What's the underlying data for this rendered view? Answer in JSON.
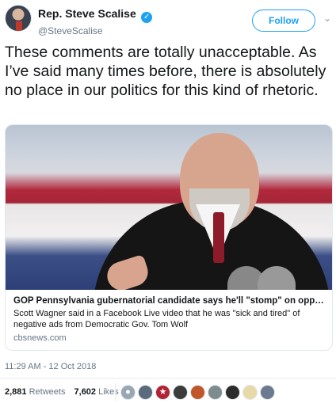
{
  "user": {
    "display_name": "Rep. Steve Scalise",
    "verified_glyph": "✓",
    "handle": "@SteveScalise"
  },
  "follow_label": "Follow",
  "more_icon": "⌄",
  "tweet_text": "These comments are totally unacceptable. As I’ve said many times before, there is absolutely no place in our politics for this kind of rhetoric.",
  "card": {
    "title": "GOP Pennsylvania gubernatorial candidate says he'll \"stomp\" on opponent's ...",
    "description": "Scott Wagner said in a Facebook Live video that he was \"sick and tired\" of negative ads from Democratic Gov. Tom Wolf",
    "domain": "cbsnews.com"
  },
  "timestamp": "11:29 AM - 12 Oct 2018",
  "stats": {
    "retweets_count": "2,881",
    "retweets_label": "Retweets",
    "likes_count": "7,602",
    "likes_label": "Likes"
  },
  "colors": {
    "accent": "#1da1f2",
    "secondary_text": "#657786"
  },
  "liker_avatars": [
    {
      "icon": "default-avatar-icon",
      "glyph": "●",
      "color": "#9aa6b2"
    },
    {
      "icon": "avatar-icon",
      "glyph": "",
      "color": "#5a6b7d"
    },
    {
      "icon": "avatar-icon",
      "glyph": "★",
      "color": "#b22234"
    },
    {
      "icon": "avatar-icon",
      "glyph": "",
      "color": "#3c3c3c"
    },
    {
      "icon": "avatar-icon",
      "glyph": "",
      "color": "#c2562b"
    },
    {
      "icon": "avatar-icon",
      "glyph": "",
      "color": "#7f8c8d"
    },
    {
      "icon": "avatar-icon",
      "glyph": "",
      "color": "#2c2c2c"
    },
    {
      "icon": "avatar-icon",
      "glyph": "",
      "color": "#e8d9a8"
    },
    {
      "icon": "avatar-icon",
      "glyph": "",
      "color": "#6b7a8f"
    }
  ]
}
